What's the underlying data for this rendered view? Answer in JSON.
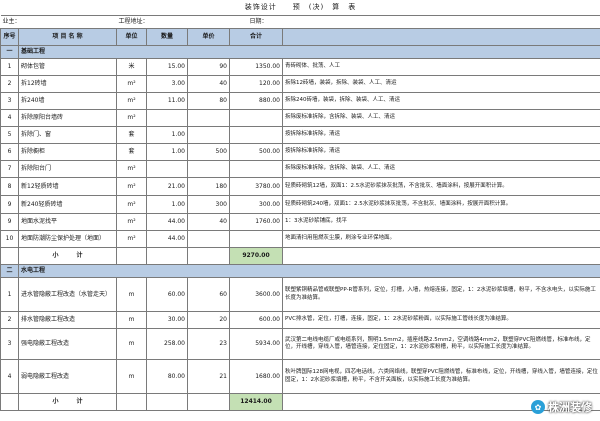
{
  "title": "装饰设计　　预　(决)　算　表",
  "meta": {
    "owner": "业主：",
    "address": "工程地址：",
    "date": "日期："
  },
  "header": {
    "no": "序号",
    "name": "项 目 名 称",
    "unit": "单位",
    "qty": "数量",
    "price": "单价",
    "total": "合计",
    "desc": ""
  },
  "sections": [
    {
      "no": "一",
      "title": "基础工程",
      "rows": [
        {
          "no": "1",
          "name": "砌体包管",
          "unit": "米",
          "qty": "15.00",
          "price": "90",
          "total": "1350.00",
          "desc": "青砖砌体、批荡、人工"
        },
        {
          "no": "2",
          "name": "拆12砖墙",
          "unit": "m²",
          "qty": "3.00",
          "price": "40",
          "total": "120.00",
          "desc": "拆除12砖墙，装袋，拆除、装袋、人工、清运"
        },
        {
          "no": "3",
          "name": "拆240墙",
          "unit": "m²",
          "qty": "11.00",
          "price": "80",
          "total": "880.00",
          "desc": "拆除240砖墙，装袋，拆除、装袋、人工、清运"
        },
        {
          "no": "4",
          "name": "拆除原阳台墙砖",
          "unit": "m²",
          "qty": "",
          "price": "",
          "total": "",
          "desc": "拆除废标准拆除，含拆除、装袋、人工、清运"
        },
        {
          "no": "5",
          "name": "拆除门、窗",
          "unit": "套",
          "qty": "1.00",
          "price": "",
          "total": "",
          "desc": "按拆除标准拆除，清运"
        },
        {
          "no": "6",
          "name": "拆除橱柜",
          "unit": "套",
          "qty": "1.00",
          "price": "500",
          "total": "500.00",
          "desc": "按拆除标准拆除，清运"
        },
        {
          "no": "7",
          "name": "拆除阳台门",
          "unit": "m²",
          "qty": "",
          "price": "",
          "total": "",
          "desc": "拆除废标准拆除，含拆除、装袋、人工、清运"
        },
        {
          "no": "8",
          "name": "新12轻质砖墙",
          "unit": "m²",
          "qty": "21.00",
          "price": "180",
          "total": "3780.00",
          "desc": "轻质砖砌筑12墙，双面1：2.5水泥砂浆抹灰批荡，不含批灰、墙面涂料，按展开面积计算。"
        },
        {
          "no": "9",
          "name": "新240轻质砖墙",
          "unit": "m²",
          "qty": "1.00",
          "price": "300",
          "total": "300.00",
          "desc": "轻质砖砌筑240墙，双面1：2.5水泥砂浆抹灰批荡，不含批灰、墙面涂料，按展开面积计算。"
        },
        {
          "no": "9",
          "name": "地面水泥找平",
          "unit": "m²",
          "qty": "44.00",
          "price": "40",
          "total": "1760.00",
          "desc": "1：3水泥砂浆铺底，找平"
        },
        {
          "no": "10",
          "name": "地面防潮防尘保护处理（地面）",
          "unit": "m²",
          "qty": "44.00",
          "price": "",
          "total": "",
          "desc": "地面清扫用阻燃灰尘膜，刷涂专业环保地面。"
        }
      ],
      "subtotal_label": "小　　　计",
      "subtotal": "9270.00"
    },
    {
      "no": "二",
      "title": "水电工程",
      "rows": [
        {
          "no": "1",
          "name": "进水管隐蔽工程改造（水管走天）",
          "unit": "m",
          "qty": "60.00",
          "price": "60",
          "total": "3600.00",
          "desc": "联塑紫铜精品管或联塑PP-R管系列，定位，打槽，入墙，热熔连接，固定，1：2水泥砂浆填槽，粉平，不含水电头，以实际施工长度为准结算。"
        },
        {
          "no": "2",
          "name": "排水管隐蔽工程改造",
          "unit": "m",
          "qty": "30.00",
          "price": "20",
          "total": "600.00",
          "desc": "PVC排水管，定位，打槽，连接，固定，1：2水泥砂浆粉面，以实际施工管线长度为准结算。"
        },
        {
          "no": "3",
          "name": "强电隐蔽工程改造",
          "unit": "m",
          "qty": "258.00",
          "price": "23",
          "total": "5934.00",
          "desc": "武汉第二电线电缆厂或电缆系列，照明1.5mm2，插座线路2.5mm2，空调线路4mm2，联塑穿PVC阻燃线管，标准布线，定位，开线槽，穿线入管，墙管连接，定位固定，1：2水泥砂浆粉槽，粉平，以实际施工长度为准结算。"
        },
        {
          "no": "4",
          "name": "弱电隐蔽工程改造",
          "unit": "m",
          "qty": "80.00",
          "price": "21",
          "total": "1680.00",
          "desc": "秋叶牌国际128网电视，四芯电话线，六类网络线，联塑穿PVC阻燃线管，标准布线，定位，开线槽，穿线入管，墙管连接，定位固定，1：2水泥砂浆填槽，粉平，不含开关面板，以实际施工长度为准结算。"
        }
      ],
      "subtotal_label": "小　　　计",
      "subtotal": "12414.00"
    }
  ],
  "watermark": {
    "icon": "wechat-icon",
    "text": "株洲装修"
  }
}
